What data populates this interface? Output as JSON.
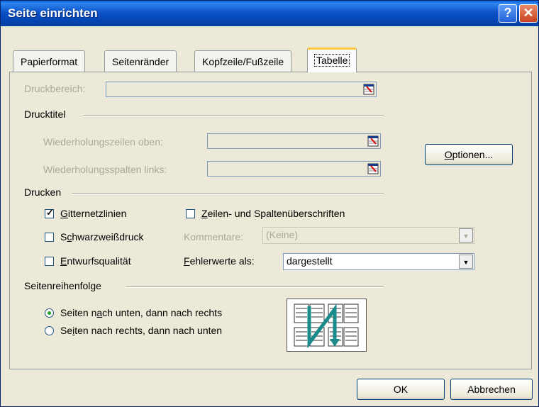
{
  "window": {
    "title": "Seite einrichten"
  },
  "tabs": [
    {
      "label": "Papierformat"
    },
    {
      "label": "Seitenränder"
    },
    {
      "label": "Kopfzeile/Fußzeile"
    },
    {
      "label": "Tabelle"
    }
  ],
  "print_area": {
    "label": "Druckbereich:",
    "value": ""
  },
  "titles_group": {
    "label": "Drucktitel",
    "rows_label": "Wiederholungszeilen oben:",
    "cols_label": "Wiederholungsspalten links:"
  },
  "print_group": {
    "label": "Drucken",
    "gridlines": {
      "label_u": "G",
      "label_rest": "itternetzlinien",
      "checked": true
    },
    "blackwhite": {
      "label_pre": "S",
      "label_u": "c",
      "label_rest": "hwarzweißdruck",
      "checked": false
    },
    "draft": {
      "label_u": "E",
      "label_rest": "ntwurfsqualität",
      "checked": false
    },
    "headings": {
      "label_u": "Z",
      "label_rest": "eilen- und Spaltenüberschriften",
      "checked": false
    },
    "comments_label": "Kommentare:",
    "comments_value": "(Keine)",
    "errors_label_u": "F",
    "errors_label_rest": "ehlerwerte als:",
    "errors_value": "dargestellt"
  },
  "order_group": {
    "label": "Seitenreihenfolge",
    "down_then_over": {
      "pre": "Seiten n",
      "u": "a",
      "rest": "ch unten, dann nach rechts",
      "selected": true
    },
    "over_then_down": {
      "pre": "Se",
      "u": "i",
      "rest": "ten nach rechts, dann nach unten",
      "selected": false
    }
  },
  "buttons": {
    "options_u": "O",
    "options_rest": "ptionen...",
    "ok": "OK",
    "cancel": "Abbrechen"
  },
  "icons": {
    "help": "?",
    "close": "✕",
    "check": "✓",
    "dropdown": "▼"
  }
}
